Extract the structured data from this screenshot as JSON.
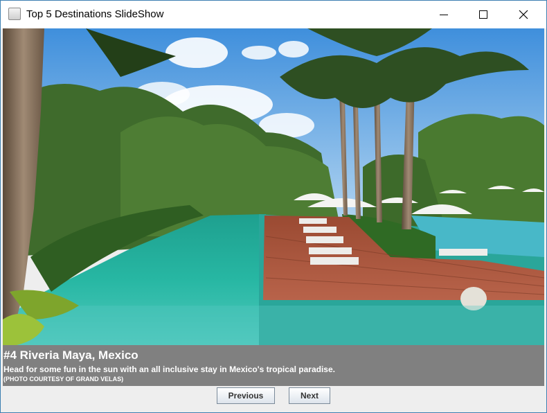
{
  "window": {
    "title": "Top 5 Destinations SlideShow"
  },
  "title_controls": {
    "minimize_icon": "minimize-icon",
    "maximize_icon": "maximize-icon",
    "close_icon": "close-icon"
  },
  "slide": {
    "heading": "#4 Riveria Maya, Mexico",
    "description": "Head for some fun in the sun with an all inclusive stay in Mexico's tropical paradise.",
    "credit": "(PHOTO COURTESY OF GRAND VELAS)"
  },
  "buttons": {
    "previous": "Previous",
    "next": "Next"
  },
  "colors": {
    "caption_background": "#808080",
    "window_border": "#3c7fb1"
  }
}
